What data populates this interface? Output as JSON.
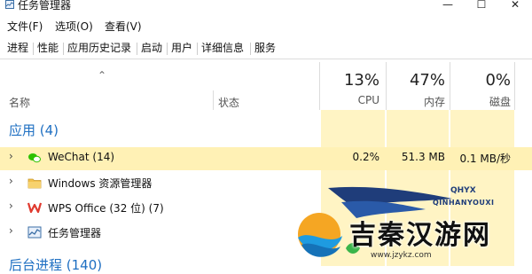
{
  "window": {
    "title": "任务管理器"
  },
  "menu": [
    "文件(F)",
    "选项(O)",
    "查看(V)"
  ],
  "tabs": [
    "进程",
    "性能",
    "应用历史记录",
    "启动",
    "用户",
    "详细信息",
    "服务"
  ],
  "header": {
    "name": "名称",
    "status": "状态",
    "cpu_pct": "13%",
    "cpu_label": "CPU",
    "mem_pct": "47%",
    "mem_label": "内存",
    "disk_pct": "0%",
    "disk_label": "磁盘"
  },
  "groups": {
    "apps": "应用 (4)",
    "background": "后台进程 (140)"
  },
  "rows": [
    {
      "name": "WeChat (14)",
      "icon": "wechat-icon",
      "cpu": "0.2%",
      "mem": "51.3 MB",
      "disk": "0.1 MB/秒"
    },
    {
      "name": "Windows 资源管理器",
      "icon": "folder-icon",
      "cpu": "",
      "mem": "",
      "disk": ""
    },
    {
      "name": "WPS Office (32 位) (7)",
      "icon": "wps-icon",
      "cpu": "",
      "mem": "",
      "disk": ""
    },
    {
      "name": "任务管理器",
      "icon": "task-manager-icon",
      "cpu": "",
      "mem": "",
      "disk": ""
    }
  ],
  "watermark": {
    "tag": "QHYX",
    "en": "QINHANYOUXI",
    "cn": "吉秦汉游网",
    "url": "www.jzykz.com"
  },
  "colors": {
    "accent": "#1e6fc2",
    "column_tint": "#fff4c4",
    "row_highlight": "#fff1b5"
  }
}
